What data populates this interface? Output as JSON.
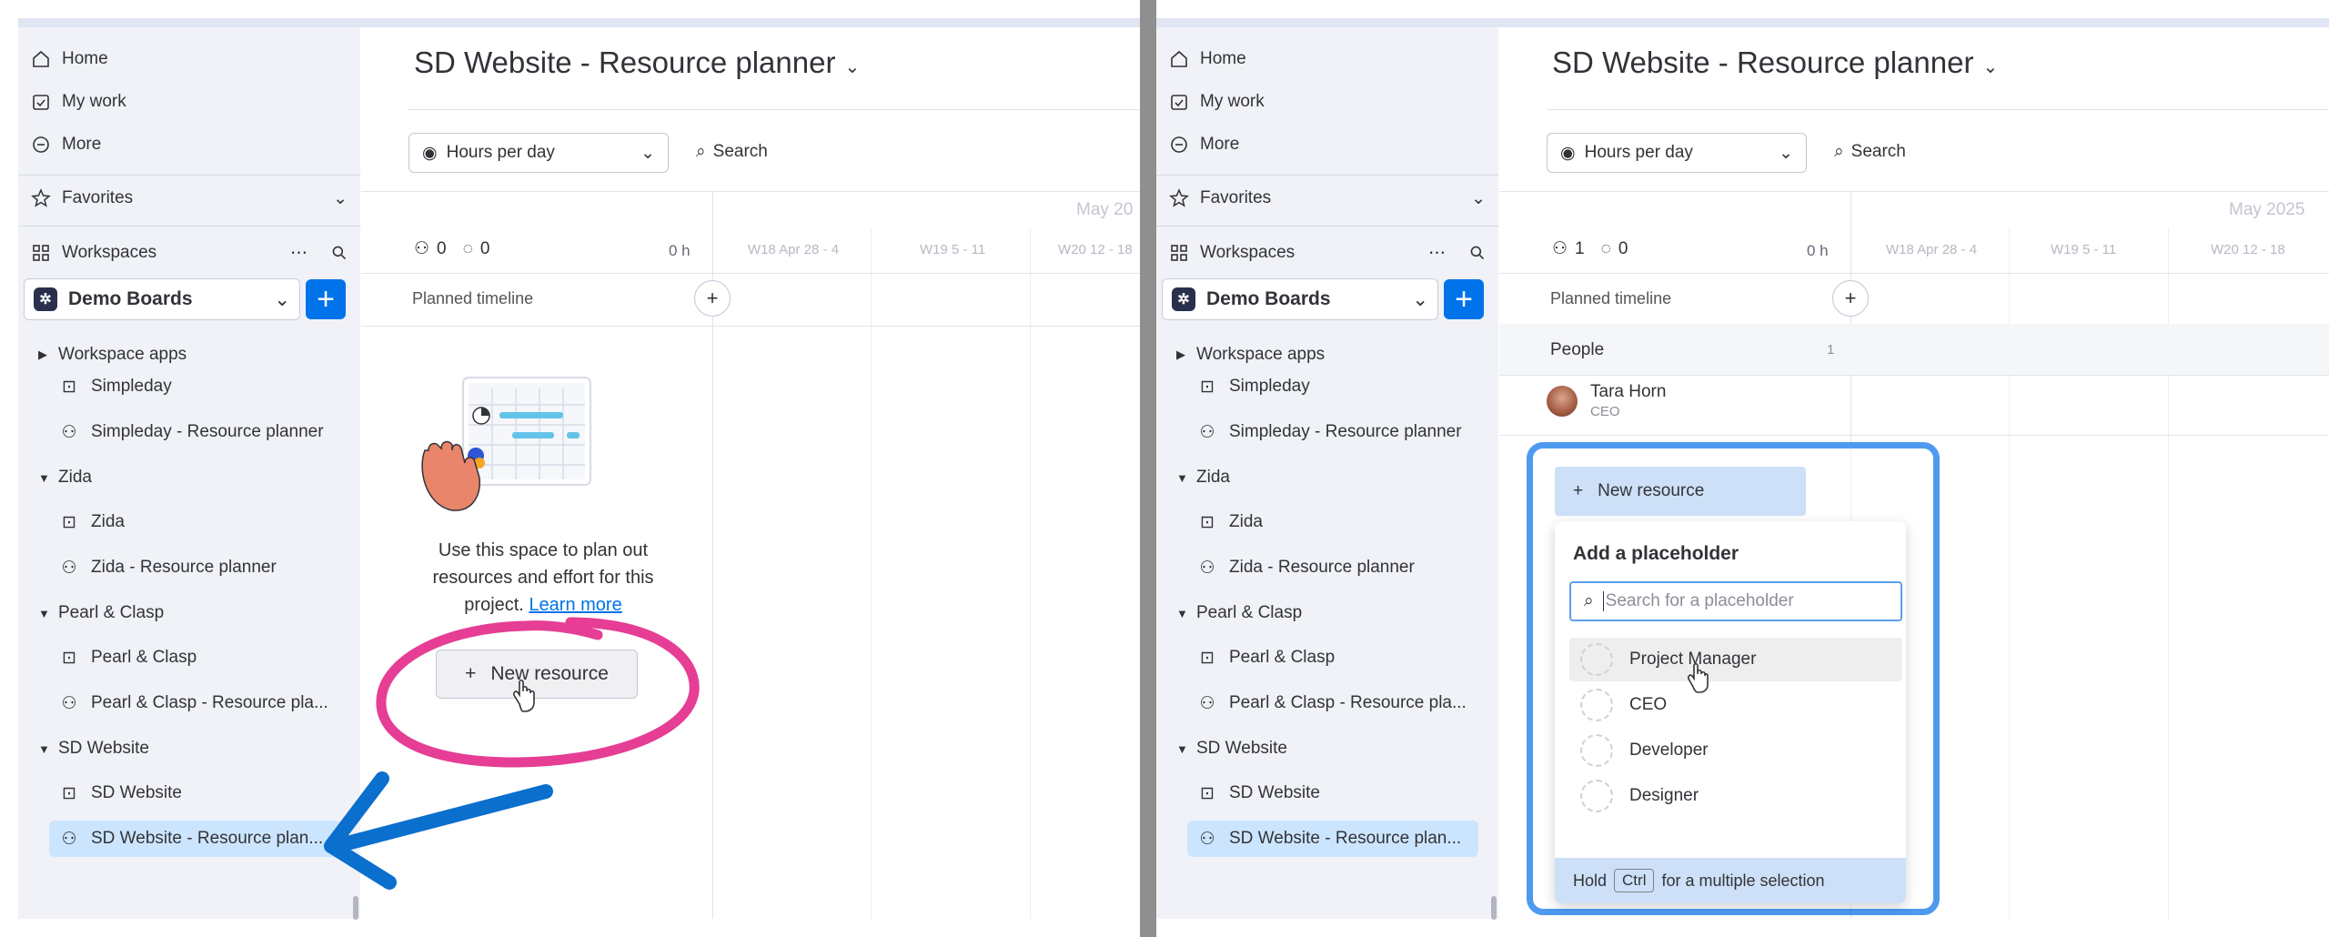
{
  "nav": {
    "home": "Home",
    "my_work": "My work",
    "more": "More",
    "favorites": "Favorites",
    "workspaces": "Workspaces"
  },
  "workspace": {
    "name": "Demo Boards",
    "add": "+"
  },
  "tree": {
    "workspace_apps": "Workspace apps",
    "simpleday": "Simpleday",
    "simpleday_rp": "Simpleday - Resource planner",
    "zida_folder": "Zida",
    "zida": "Zida",
    "zida_rp": "Zida - Resource planner",
    "pearl_folder": "Pearl & Clasp",
    "pearl": "Pearl & Clasp",
    "pearl_rp": "Pearl & Clasp - Resource pla...",
    "sd_folder": "SD Website",
    "sd": "SD Website",
    "sd_rp": "SD Website - Resource plan..."
  },
  "board": {
    "title": "SD Website - Resource planner",
    "view_select": "Hours per day",
    "search": "Search",
    "planned_timeline": "Planned timeline",
    "zero_hours": "0 h",
    "weeks": [
      "W18 Apr 28 - 4",
      "W19 5 - 11",
      "W20 12 - 18"
    ]
  },
  "left": {
    "month": "May 20",
    "people_count": "0",
    "placeholder_count": "0",
    "empty_text": "Use this space to plan out resources and effort for this project.",
    "learn_more": "Learn more",
    "new_resource": "New resource"
  },
  "right": {
    "month": "May 2025",
    "people_count": "1",
    "placeholder_count": "0",
    "people_label": "People",
    "people_group_count": "1",
    "person_name": "Tara Horn",
    "person_role": "CEO",
    "new_resource": "New resource",
    "popup_title": "Add a placeholder",
    "search_placeholder": "Search for a placeholder",
    "options": [
      "Project Manager",
      "CEO",
      "Developer",
      "Designer"
    ],
    "hint_hold": "Hold",
    "hint_key": "Ctrl",
    "hint_rest": "for a multiple selection"
  },
  "colors": {
    "accent": "#0073ea",
    "highlight_circle": "#e63d95",
    "arrow": "#0b6fcd",
    "frame": "#4d9af0"
  }
}
